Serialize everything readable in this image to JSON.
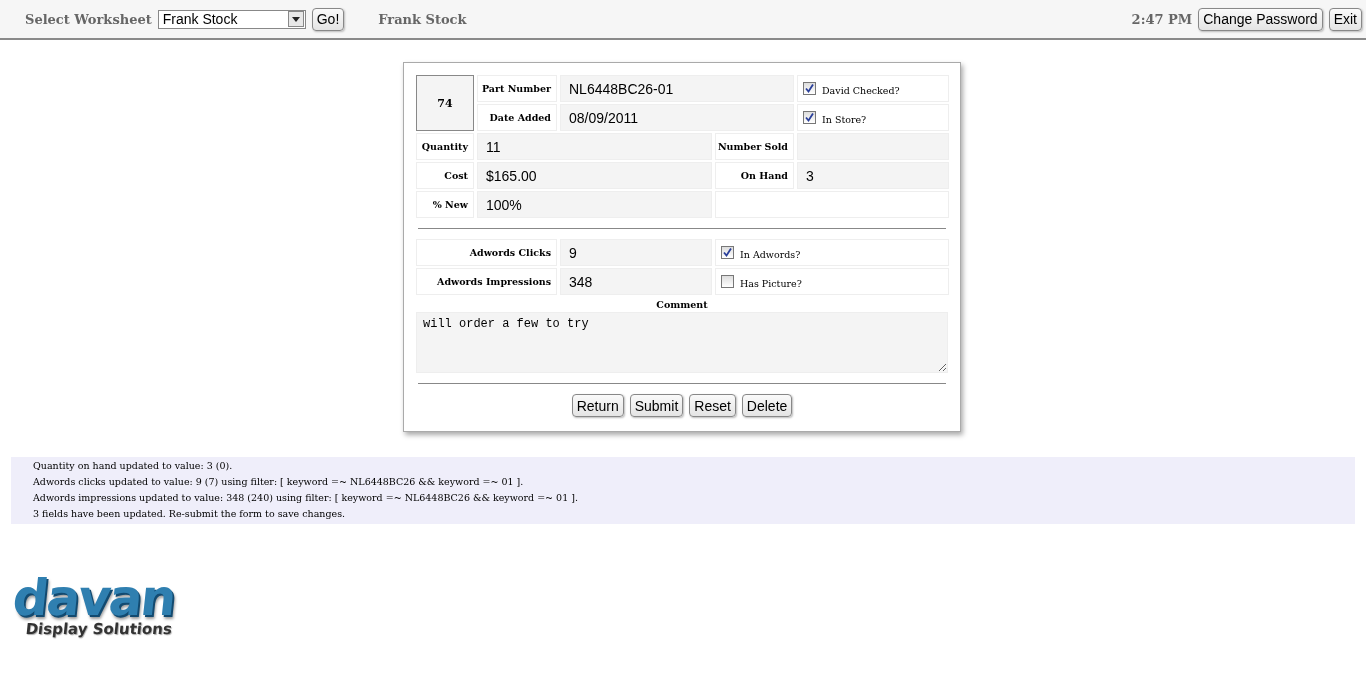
{
  "header": {
    "select_label": "Select Worksheet",
    "worksheet": "Frank Stock",
    "go_button": "Go!",
    "worksheet_title": "Frank Stock",
    "time": "2:47 PM",
    "buttons": [
      "Change Password",
      "Exit"
    ]
  },
  "record": {
    "id": "74",
    "part_number": {
      "label": "Part Number",
      "value": "NL6448BC26-01"
    },
    "date_added": {
      "label": "Date Added",
      "value": "08/09/2011"
    },
    "flags": [
      {
        "label": "David Checked?",
        "checked": true
      },
      {
        "label": "In Store?",
        "checked": true
      }
    ],
    "grid_rows": [
      {
        "label": "Quantity",
        "value": "11",
        "label_2": "Number Sold"
      },
      {
        "label": "Cost",
        "value": "$165.00",
        "label_2": "On Hand",
        "value_2": "3"
      },
      {
        "label": "% New",
        "value": "100%"
      }
    ],
    "adwords": [
      {
        "label": "Adwords Clicks",
        "value": "9",
        "flag": "In Adwords?",
        "checked": true
      },
      {
        "label": "Adwords Impressions",
        "value": "348",
        "flag": "Has Picture?",
        "checked": false
      }
    ],
    "comment_label": "Comment",
    "comment": "will order a few to try",
    "buttons": [
      "Return",
      "Submit",
      "Reset",
      "Delete"
    ]
  },
  "messages": [
    "Quantity on hand updated to value: 3 (0).",
    "Adwords clicks updated to value: 9 (7) using filter: [ keyword =~ NL6448BC26 && keyword =~ 01 ].",
    "Adwords impressions updated to value: 348 (240) using filter: [ keyword =~ NL6448BC26 && keyword =~ 01 ].",
    "3 fields have been updated. Re-submit the form to save changes."
  ],
  "logo": {
    "name": "davan",
    "tagline": "Display Solutions"
  }
}
